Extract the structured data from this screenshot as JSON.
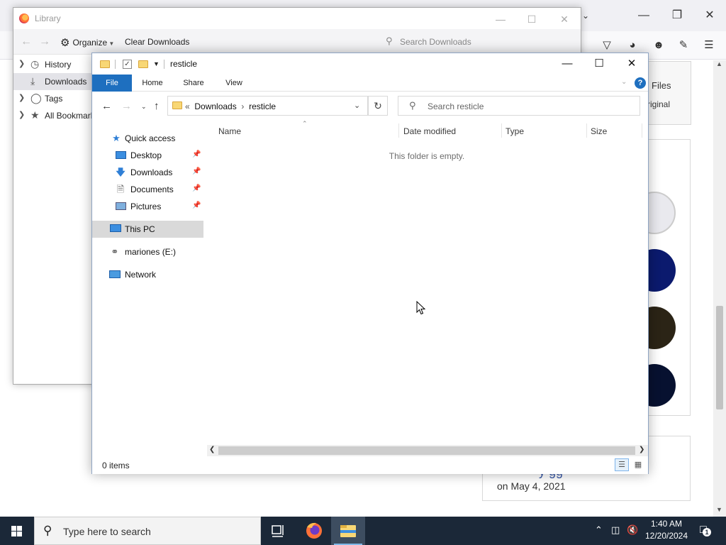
{
  "browser": {
    "files_label": "Files",
    "original_label": "riginal",
    "date_text": "on May 4, 2021",
    "partial_text": "y gg",
    "toolbar_icons": [
      "pocket-icon",
      "history-icon",
      "account-icon",
      "extensions-icon",
      "menu-icon"
    ]
  },
  "library": {
    "title": "Library",
    "organize_label": "Organize",
    "clear_label": "Clear Downloads",
    "search_placeholder": "Search Downloads",
    "sidebar": [
      {
        "label": "History",
        "icon": "clock-icon"
      },
      {
        "label": "Downloads",
        "icon": "download-icon"
      },
      {
        "label": "Tags",
        "icon": "tag-icon"
      },
      {
        "label": "All Bookmarks",
        "icon": "star-icon"
      }
    ]
  },
  "explorer": {
    "title": "resticle",
    "ribbon_tabs": [
      "File",
      "Home",
      "Share",
      "View"
    ],
    "breadcrumb_prefix": "«",
    "breadcrumb": [
      "Downloads",
      "resticle"
    ],
    "breadcrumb_sep": "›",
    "search_placeholder": "Search resticle",
    "nav": {
      "quick_access": "Quick access",
      "desktop": "Desktop",
      "downloads": "Downloads",
      "documents": "Documents",
      "pictures": "Pictures",
      "this_pc": "This PC",
      "drive": "mariones (E:)",
      "network": "Network"
    },
    "columns": [
      "Name",
      "Date modified",
      "Type",
      "Size"
    ],
    "empty_message": "This folder is empty.",
    "status_count": "0 items"
  },
  "taskbar": {
    "search_placeholder": "Type here to search",
    "time": "1:40 AM",
    "date": "12/20/2024",
    "notification_count": "1"
  },
  "colors": {
    "accent": "#1e6fbf",
    "taskbar": "#1b2838",
    "selection": "#d9d9d9",
    "folder": "#f8d775"
  }
}
